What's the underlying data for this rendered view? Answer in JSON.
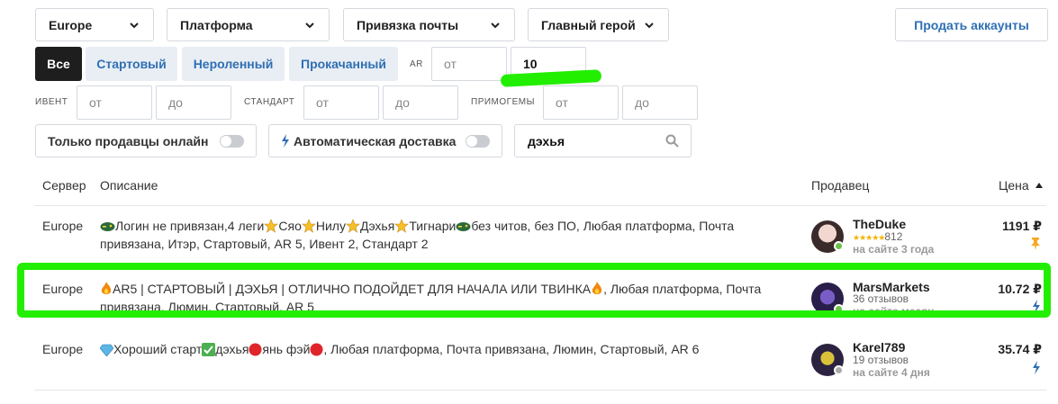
{
  "filters": {
    "server": "Europe",
    "platform": "Платформа",
    "mail_binding": "Привязка почты",
    "main_hero": "Главный герой",
    "sell_button": "Продать аккаунты"
  },
  "tabs": [
    {
      "label": "Все",
      "active": true
    },
    {
      "label": "Стартовый",
      "active": false
    },
    {
      "label": "Нероленный",
      "active": false
    },
    {
      "label": "Прокачанный",
      "active": false
    }
  ],
  "ar": {
    "label": "AR",
    "from_placeholder": "от",
    "to_value": "10"
  },
  "event": {
    "label": "ИВЕНТ",
    "from": "от",
    "to": "до"
  },
  "standard": {
    "label": "СТАНДАРТ",
    "from": "от",
    "to": "до"
  },
  "primogems": {
    "label": "ПРИМОГЕМЫ",
    "from": "от",
    "to": "до"
  },
  "toggles": {
    "online_only": "Только продавцы онлайн",
    "auto_delivery": "Автоматическая доставка"
  },
  "search": {
    "value": "дэхья"
  },
  "table": {
    "headers": {
      "server": "Сервер",
      "description": "Описание",
      "seller": "Продавец",
      "price": "Цена"
    },
    "rows": [
      {
        "server": "Europe",
        "desc_parts": [
          "Логин не привязан,4 леги",
          "Сяо",
          "Нилу",
          "Дэхья",
          "Тигнари",
          "без читов, без ПО, Любая платформа, Почта",
          "привязана, Итэр, Стартовый, AR 5, Ивент 2, Стандарт 2"
        ],
        "seller": "TheDuke",
        "reviews": "812",
        "online": "на сайте 3 года",
        "price": "1191 ₽"
      },
      {
        "server": "Europe",
        "desc_parts": [
          "AR5 | СТАРТОВЫЙ | ДЭХЬЯ | ОТЛИЧНО ПОДОЙДЕТ ДЛЯ НАЧАЛА ИЛИ ТВИНКА",
          ", Любая платформа, Почта",
          "привязана, Люмин, Стартовый, AR 5"
        ],
        "seller": "MarsMarkets",
        "reviews": "36 отзывов",
        "online": "на сайте месяц",
        "price": "10.72 ₽"
      },
      {
        "server": "Europe",
        "desc_parts": [
          "Хороший старт",
          "дэхья",
          "янь фэй",
          ", Любая платформа, Почта привязана, Люмин, Стартовый, AR 6"
        ],
        "seller": "Karel789",
        "reviews": "19 отзывов",
        "online": "на сайте 4 дня",
        "price": "35.74 ₽"
      }
    ]
  },
  "colors": {
    "accent": "#2f6fb3",
    "highlight": "#22ee00",
    "online": "#6cc04a",
    "offline": "#aaaaaa"
  }
}
